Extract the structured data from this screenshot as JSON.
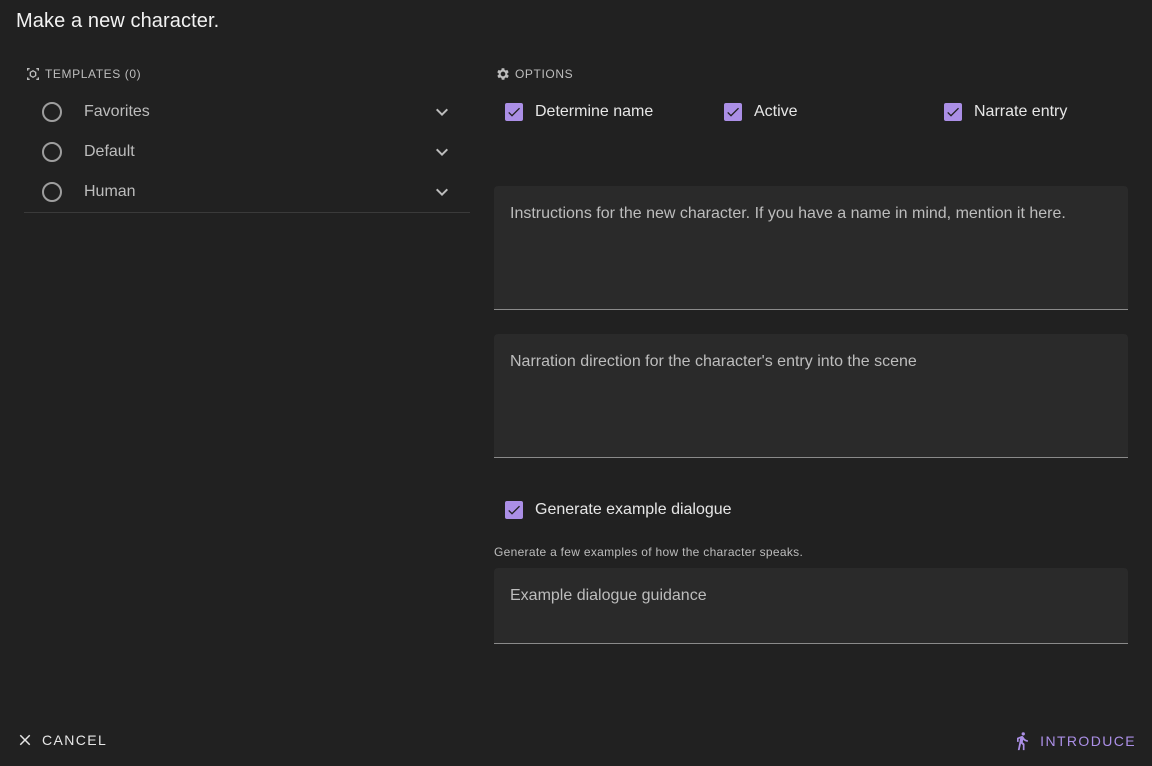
{
  "dialog": {
    "title": "Make a new character."
  },
  "templates": {
    "header": "TEMPLATES (0)",
    "items": [
      {
        "label": "Favorites"
      },
      {
        "label": "Default"
      },
      {
        "label": "Human"
      }
    ]
  },
  "options": {
    "header": "OPTIONS",
    "determine_name": {
      "label": "Determine name",
      "checked": true
    },
    "active": {
      "label": "Active",
      "checked": true
    },
    "narrate_entry": {
      "label": "Narrate entry",
      "checked": true
    },
    "generate_dialogue": {
      "label": "Generate example dialogue",
      "checked": true
    }
  },
  "fields": {
    "instructions": {
      "placeholder": "Instructions for the new character. If you have a name in mind, mention it here."
    },
    "narration": {
      "placeholder": "Narration direction for the character's entry into the scene"
    },
    "dialogue_hint": "Generate a few examples of how the character speaks.",
    "dialogue": {
      "placeholder": "Example dialogue guidance"
    }
  },
  "actions": {
    "cancel": "Cancel",
    "introduce": "Introduce"
  },
  "colors": {
    "accent": "#ab8fe6",
    "background": "#212121",
    "field_bg": "#2a2a2a"
  }
}
